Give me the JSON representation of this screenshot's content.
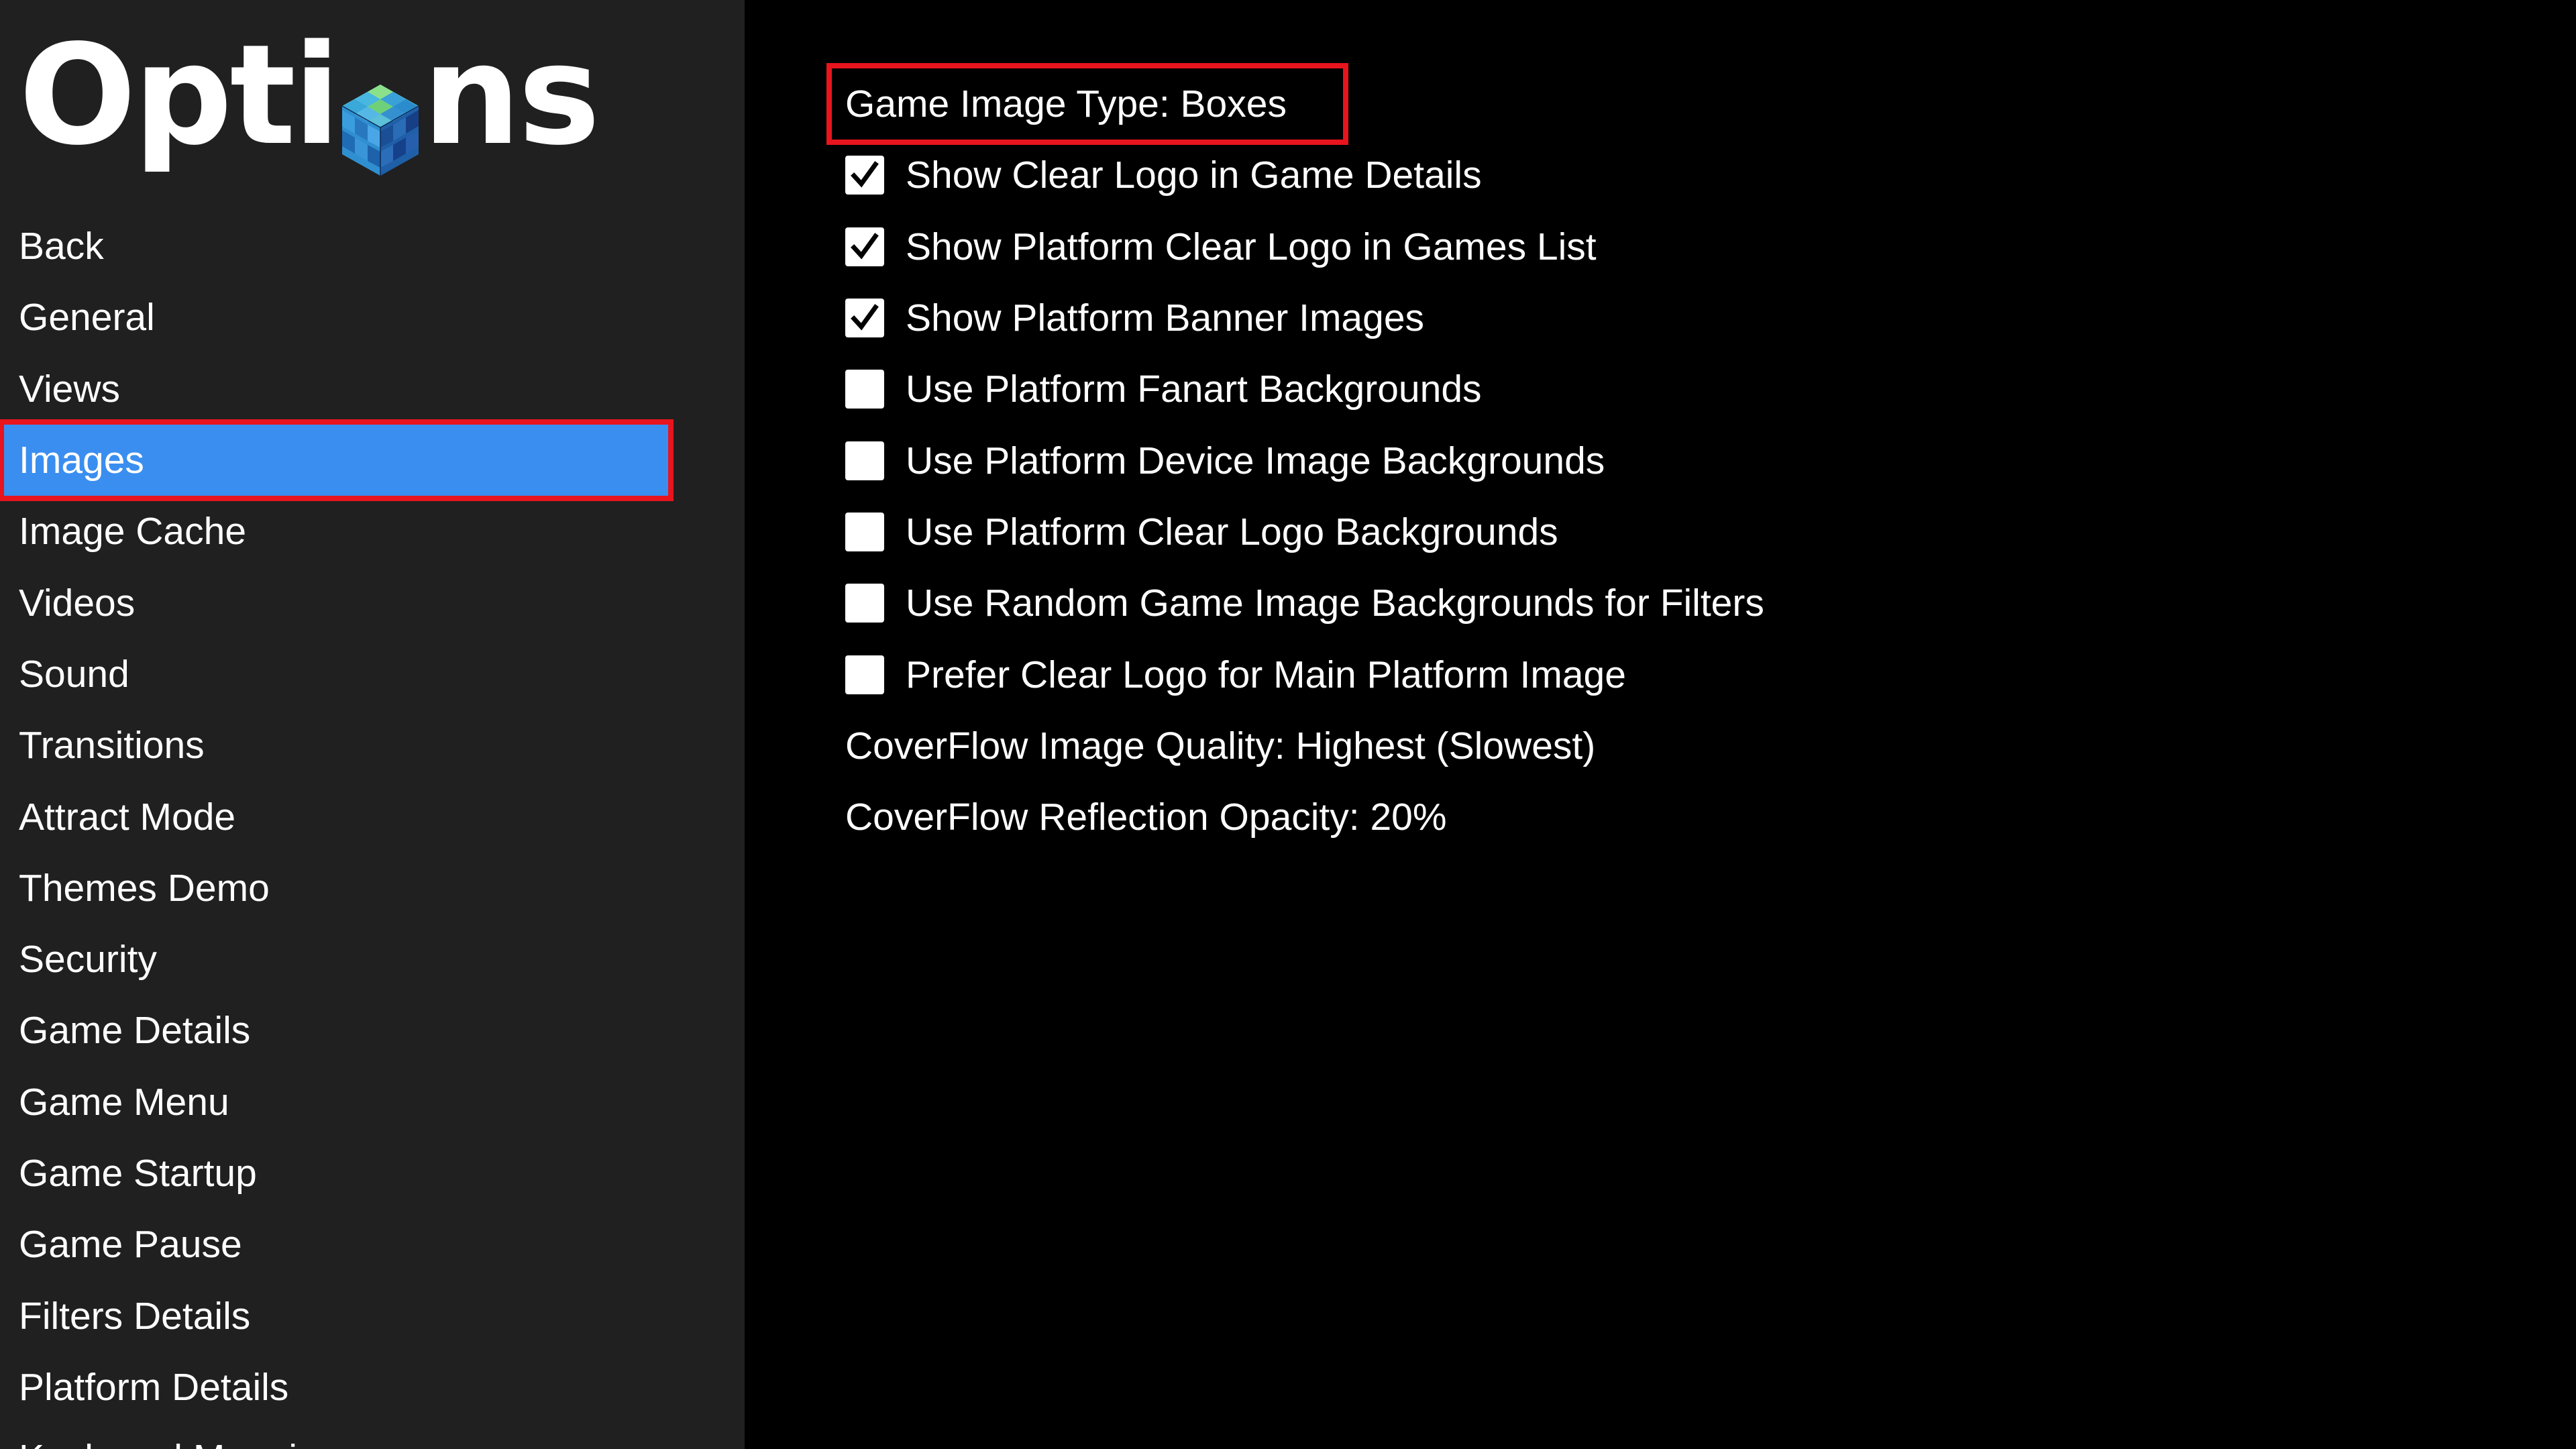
{
  "app": {
    "title_before": "Opti",
    "title_after": "ns"
  },
  "sidebar": {
    "items": [
      {
        "label": "Back"
      },
      {
        "label": "General"
      },
      {
        "label": "Views"
      },
      {
        "label": "Images",
        "selected": true
      },
      {
        "label": "Image Cache"
      },
      {
        "label": "Videos"
      },
      {
        "label": "Sound"
      },
      {
        "label": "Transitions"
      },
      {
        "label": "Attract Mode"
      },
      {
        "label": "Themes Demo"
      },
      {
        "label": "Security"
      },
      {
        "label": "Game Details"
      },
      {
        "label": "Game Menu"
      },
      {
        "label": "Game Startup"
      },
      {
        "label": "Game Pause"
      },
      {
        "label": "Filters Details"
      },
      {
        "label": "Platform Details"
      },
      {
        "label": "Keyboard Mapping"
      }
    ]
  },
  "options": {
    "game_image_type": "Game Image Type: Boxes",
    "checkboxes": [
      {
        "label": "Show Clear Logo in Game Details",
        "checked": true
      },
      {
        "label": "Show Platform Clear Logo in Games List",
        "checked": true
      },
      {
        "label": "Show Platform Banner Images",
        "checked": true
      },
      {
        "label": "Use Platform Fanart Backgrounds",
        "checked": false
      },
      {
        "label": "Use Platform Device Image Backgrounds",
        "checked": false
      },
      {
        "label": "Use Platform Clear Logo Backgrounds",
        "checked": false
      },
      {
        "label": "Use Random Game Image Backgrounds for Filters",
        "checked": false
      },
      {
        "label": "Prefer Clear Logo for Main Platform Image",
        "checked": false
      }
    ],
    "coverflow_quality": "CoverFlow Image Quality: Highest (Slowest)",
    "coverflow_reflection": "CoverFlow Reflection Opacity: 20%"
  },
  "colors": {
    "sidebar_bg": "#202020",
    "content_bg": "#000000",
    "selection_bg": "#3a8ef0",
    "annotation_red": "#e8141e"
  },
  "icons": {
    "logo": "launchbox-cube-icon",
    "checked": "check-mark-icon"
  }
}
